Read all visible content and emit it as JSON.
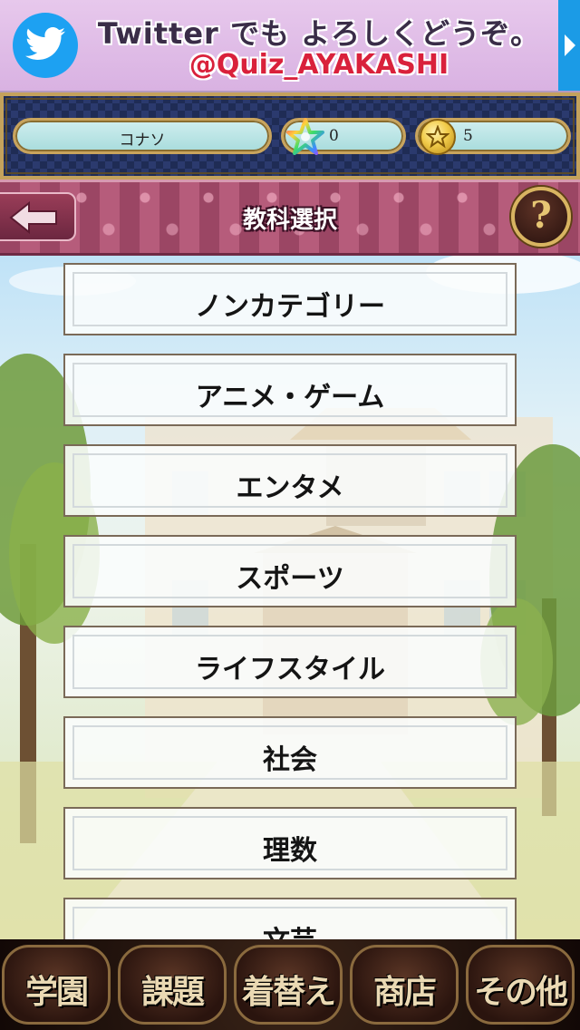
{
  "banner": {
    "line1": "Twitter でも よろしくどうぞ。",
    "line2": "@Quiz_AYAKASHI"
  },
  "status": {
    "player_name": "コナソ",
    "gems": "0",
    "coins": "5"
  },
  "header": {
    "title": "教科選択"
  },
  "categories": [
    {
      "label": "ノンカテゴリー"
    },
    {
      "label": "アニメ・ゲーム"
    },
    {
      "label": "エンタメ"
    },
    {
      "label": "スポーツ"
    },
    {
      "label": "ライフスタイル"
    },
    {
      "label": "社会"
    },
    {
      "label": "理数"
    },
    {
      "label": "文芸"
    }
  ],
  "nav": [
    {
      "label": "学園"
    },
    {
      "label": "課題"
    },
    {
      "label": "着替え"
    },
    {
      "label": "商店"
    },
    {
      "label": "その他"
    }
  ],
  "colors": {
    "twitter_blue": "#1da1f2",
    "banner_bg": "#e7c8ec",
    "handle_red": "#d9213b",
    "title_bar": "#a8506e",
    "gold_frame": "#c4a25c",
    "nav_text": "#ead9b3"
  }
}
